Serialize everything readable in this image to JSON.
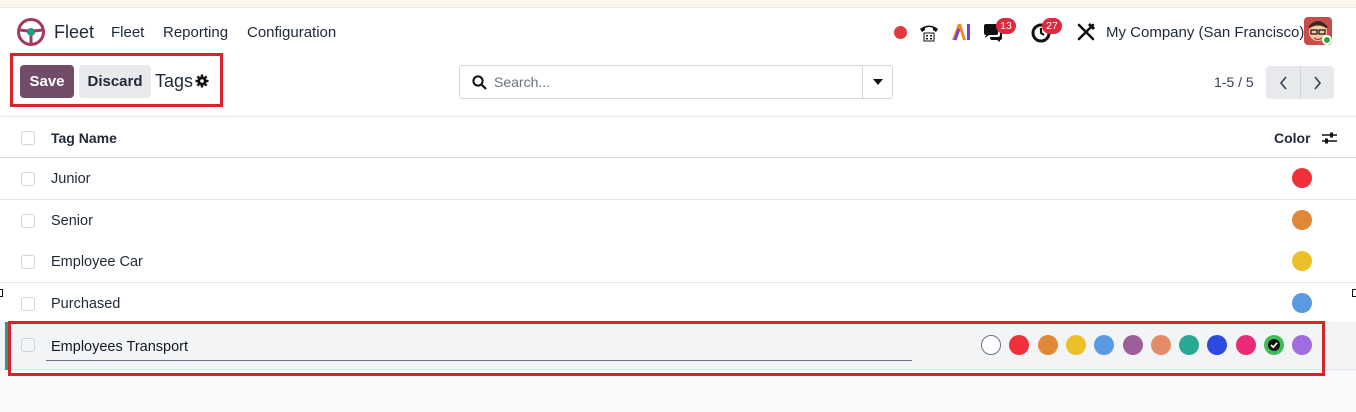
{
  "navbar": {
    "app_name": "Fleet",
    "menu": [
      "Fleet",
      "Reporting",
      "Configuration"
    ],
    "chat_badge": "13",
    "activity_badge": "27",
    "company": "My Company (San Francisco)"
  },
  "control": {
    "save_label": "Save",
    "discard_label": "Discard",
    "title": "Tags",
    "search_placeholder": "Search...",
    "pager": "1-5 / 5"
  },
  "table": {
    "col_name": "Tag Name",
    "col_color": "Color",
    "rows": [
      {
        "name": "Junior",
        "color": "#f0303a"
      },
      {
        "name": "Senior",
        "color": "#e08838"
      },
      {
        "name": "Employee Car",
        "color": "#ecc02a"
      },
      {
        "name": "Purchased",
        "color": "#5b9ae0"
      }
    ],
    "editing_row": {
      "name": "Employees Transport",
      "palette": [
        "#ffffff",
        "#f0303a",
        "#e08838",
        "#ecc02a",
        "#5b9ae0",
        "#9c5f9a",
        "#e48b68",
        "#2aa894",
        "#2d4ae0",
        "#ea2b7a",
        "#3fbd5b",
        "#a06ddf"
      ],
      "selected_index": 10
    }
  },
  "colors": {
    "primary": "#714b67",
    "highlight": "#d8232a"
  }
}
